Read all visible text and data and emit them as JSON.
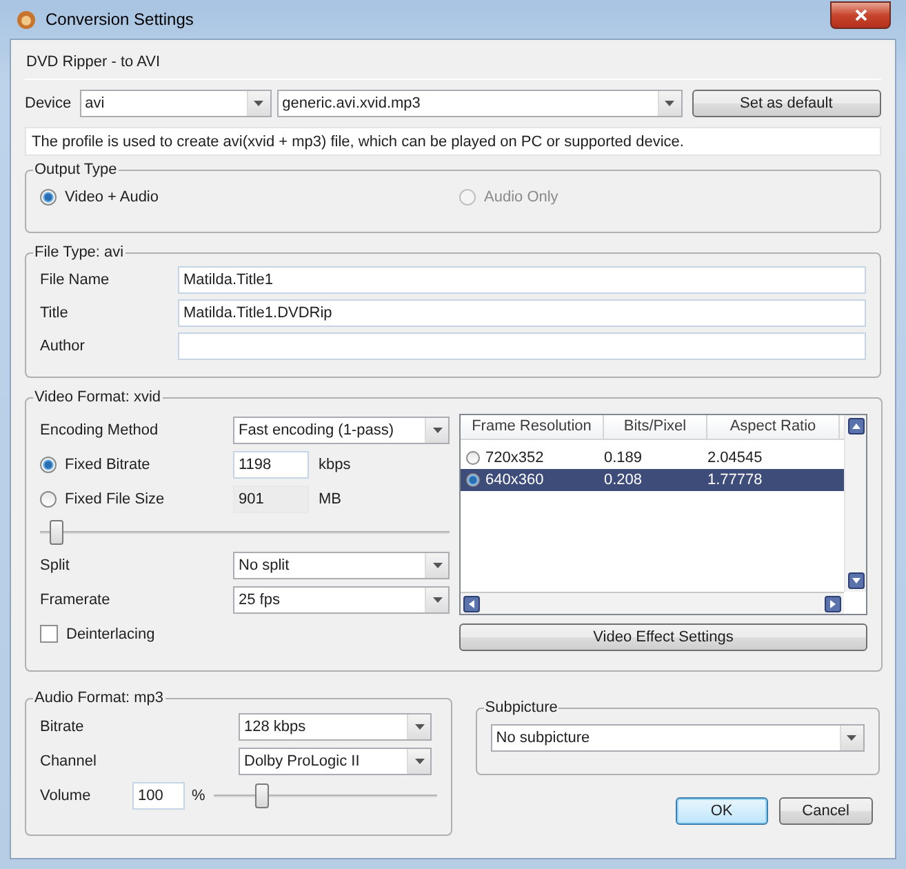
{
  "window": {
    "title": "Conversion Settings"
  },
  "header": "DVD Ripper - to AVI",
  "device": {
    "label": "Device",
    "format": "avi",
    "profile": "generic.avi.xvid.mp3",
    "default_button": "Set as default"
  },
  "description": "The profile is used to create avi(xvid + mp3) file, which can be played on PC or supported device.",
  "output_type": {
    "title": "Output Type",
    "options": [
      {
        "label": "Video + Audio",
        "selected": true,
        "disabled": false
      },
      {
        "label": "Audio Only",
        "selected": false,
        "disabled": true
      }
    ]
  },
  "file_type": {
    "title": "File Type: avi",
    "fields": [
      {
        "label": "File Name",
        "value": "Matilda.Title1"
      },
      {
        "label": "Title",
        "value": "Matilda.Title1.DVDRip"
      },
      {
        "label": "Author"
      }
    ]
  },
  "video_format": {
    "title": "Video Format: xvid",
    "encoding_method": {
      "label": "Encoding Method",
      "value": "Fast encoding (1-pass)"
    },
    "size_modes": [
      {
        "label": "Fixed Bitrate",
        "value": "1198",
        "unit": "kbps",
        "selected": true
      },
      {
        "label": "Fixed File Size",
        "value": "901",
        "unit": "MB",
        "selected": false
      }
    ],
    "quality_slider": {
      "level": 0.03
    },
    "split": {
      "label": "Split",
      "value": "No split"
    },
    "framerate": {
      "label": "Framerate",
      "value": "25 fps"
    },
    "deinterlacing": {
      "label": "Deinterlacing",
      "checked": false
    },
    "resolutions": {
      "columns": [
        "Frame Resolution",
        "Bits/Pixel",
        "Aspect Ratio"
      ],
      "rows": [
        {
          "cells": [
            "720x352",
            "0.189",
            "2.04545"
          ],
          "selected": false
        },
        {
          "cells": [
            "640x360",
            "0.208",
            "1.77778"
          ],
          "selected": true
        }
      ]
    },
    "effects_button": "Video Effect Settings"
  },
  "audio_format": {
    "title": "Audio Format: mp3",
    "bitrate": {
      "label": "Bitrate",
      "value": "128 kbps"
    },
    "channel": {
      "label": "Channel",
      "value": "Dolby ProLogic II"
    },
    "volume": {
      "label": "Volume",
      "value": "100",
      "unit": "%",
      "level": 0.2
    }
  },
  "subpicture": {
    "title": "Subpicture",
    "value": "No subpicture"
  },
  "buttons": [
    {
      "label": "OK",
      "default": true
    },
    {
      "label": "Cancel",
      "default": false
    }
  ]
}
